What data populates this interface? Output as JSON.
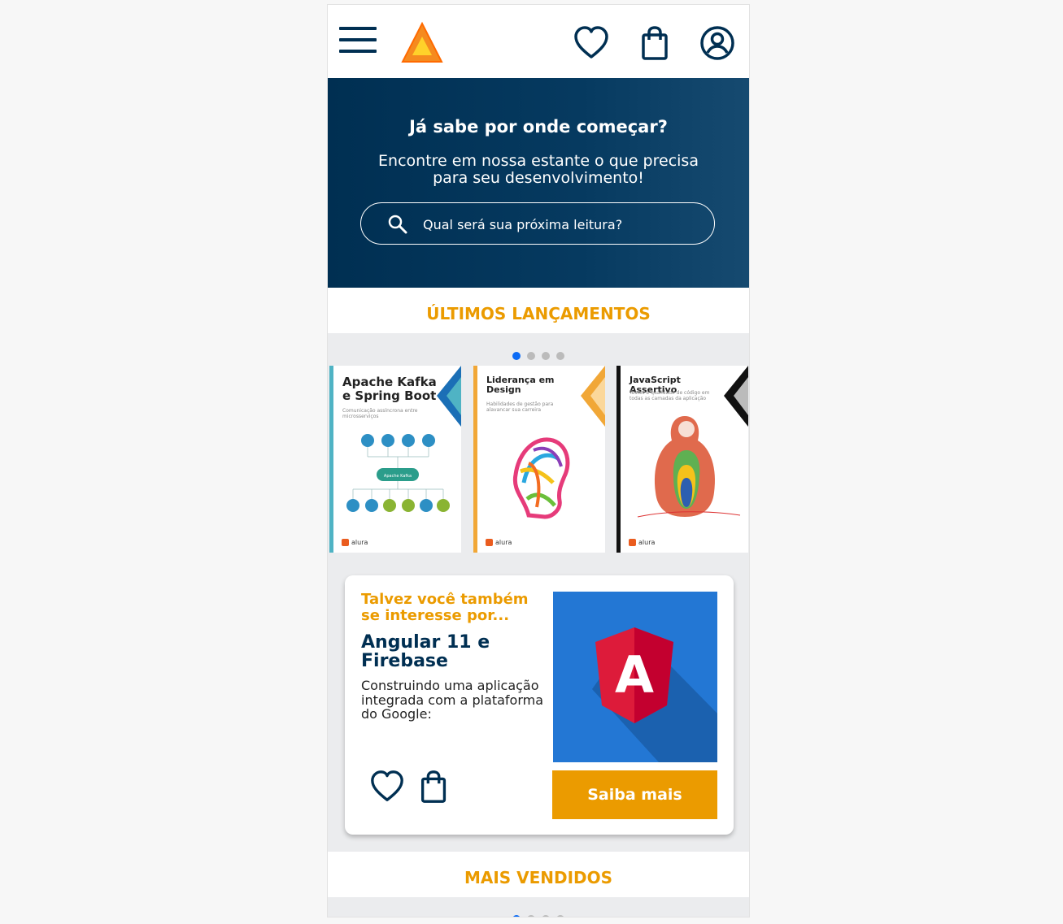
{
  "header": {
    "menu_icon": "hamburger-menu-icon",
    "logo": "triangle-logo",
    "icons": [
      "heart-icon",
      "shopping-bag-icon",
      "user-icon"
    ]
  },
  "banner": {
    "title": "Já sabe por onde começar?",
    "subtitle": "Encontre em nossa estante o que precisa para seu desenvolvimento!",
    "search_placeholder": "Qual será sua próxima leitura?"
  },
  "latest": {
    "title": "ÚLTIMOS LANÇAMENTOS",
    "dots": 4,
    "active_dot": 1,
    "books": [
      {
        "title": "Apache Kafka e Spring Boot",
        "subtitle": "Comunicação assíncrona entre microsserviços",
        "diagram_center": "Apache Kafka",
        "publisher": "alura",
        "color": "#4fb3c4"
      },
      {
        "title": "Liderança em Design",
        "subtitle": "Habilidades de gestão para alavancar sua carreira",
        "publisher": "alura",
        "color": "#f1a737"
      },
      {
        "title": "JavaScript Assertivo",
        "subtitle": "Testes e qualidade de código em todas as camadas da aplicação",
        "publisher": "alura",
        "color": "#111111"
      }
    ]
  },
  "recommendation": {
    "kicker": "Talvez você também se interesse por...",
    "title": "Angular 11 e Firebase",
    "description": "Construindo uma aplicação integrada com a plataforma do Google:",
    "image_letter": "A",
    "button": "Saiba mais",
    "icons": [
      "heart-icon",
      "shopping-bag-icon"
    ]
  },
  "best_sellers": {
    "title": "MAIS VENDIDOS",
    "dots": 4,
    "active_dot": 1
  },
  "colors": {
    "navy": "#002f52",
    "orange": "#eb9b00",
    "active_dot": "#0b6bf5",
    "gray_bg": "#ebecee"
  }
}
